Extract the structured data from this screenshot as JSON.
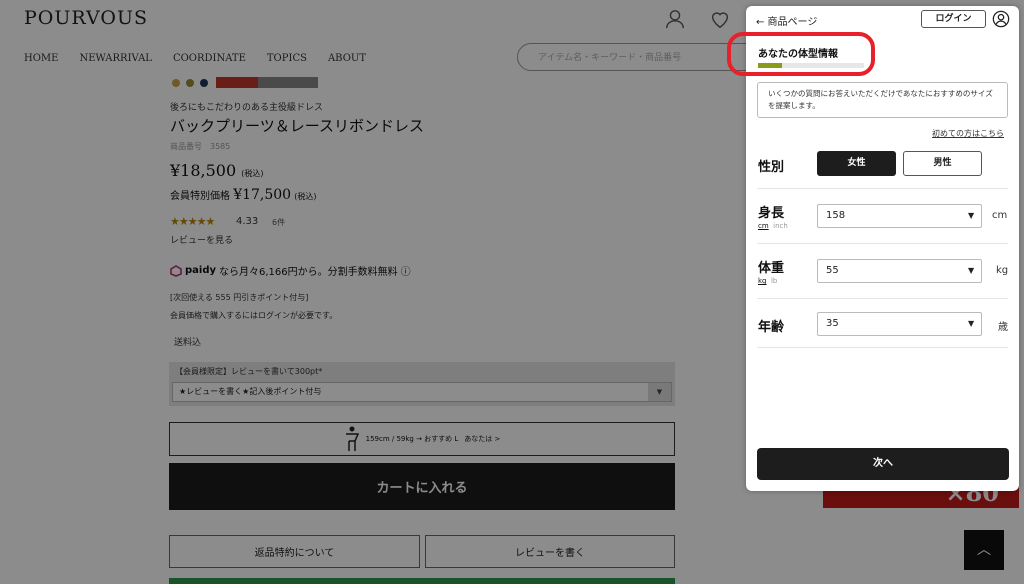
{
  "header": {
    "logo": "POURVOUS",
    "nav": [
      "HOME",
      "NEWARRIVAL",
      "COORDINATE",
      "TOPICS",
      "ABOUT"
    ],
    "search_placeholder": "アイテム名・キーワード・商品番号"
  },
  "product": {
    "subtitle": "後ろにもこだわりのある主役級ドレス",
    "title": "バックプリーツ＆レースリボンドレス",
    "code": "商品番号　3585",
    "price": "¥18,500",
    "tax_note": "(税込)",
    "member_price_label": "会員特別価格",
    "member_price": "¥17,500",
    "stars": "★★★★★",
    "rating": "4.33",
    "review_count": "6件",
    "see_reviews": "レビューを見る",
    "paidy_logo": "paidy",
    "paidy_text": "なら月々6,166円から。分割手数料無料",
    "paidy_info_icon": "ⓘ",
    "point_note": "[次回使える 555 円引きポイント付与]",
    "login_note": "会員価格で購入するにはログインが必要です。",
    "shipping": "送料込",
    "review_campaign_label": "【会員様限定】レビューを書いて300pt*",
    "review_campaign_option": "★レビューを書く★記入後ポイント付与",
    "size_recommend": "159cm / 59kg → おすすめ L",
    "size_recommend_link": "あなたは >",
    "cart_button": "カートに入れる",
    "return_button": "返品特約について",
    "write_review_button": "レビューを書く",
    "banner_text": "×80"
  },
  "modal": {
    "back_label": "← 商品ページ",
    "login_label": "ログイン",
    "heading": "あなたの体型情報",
    "progress_fraction": 0.23,
    "intro_text": "いくつかの質問にお答えいただくだけであなたにおすすめのサイズを提案します。",
    "first_time_link": "初めての方はこちら",
    "gender": {
      "label": "性別",
      "female": "女性",
      "male": "男性",
      "selected": "female"
    },
    "height": {
      "label": "身長",
      "value": "158",
      "unit": "cm",
      "toggle_on": "cm",
      "toggle_off": "inch"
    },
    "weight": {
      "label": "体重",
      "value": "55",
      "unit": "kg",
      "toggle_on": "kg",
      "toggle_off": "lb"
    },
    "age": {
      "label": "年齢",
      "value": "35",
      "unit": "歳"
    },
    "next_button": "次へ"
  },
  "colors": {
    "accent_dark": "#1d1d1d",
    "highlight_red": "#e8202a",
    "progress_green": "#8a9a1a",
    "sale_red": "#c21b1b",
    "cta_green": "#2f9a4a"
  }
}
